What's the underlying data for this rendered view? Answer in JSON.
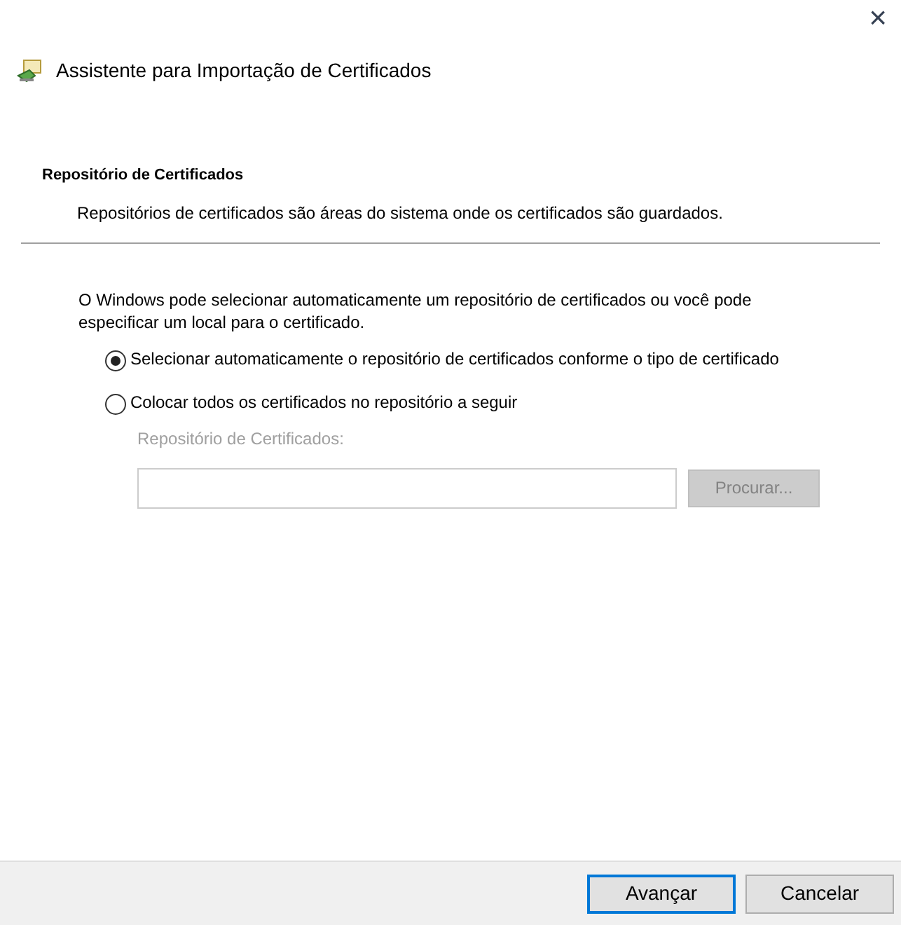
{
  "window": {
    "close": "×",
    "title": "Assistente para Importação de Certificados"
  },
  "header": {
    "heading": "Repositório de Certificados",
    "description": "Repositórios de certificados são áreas do sistema onde os certificados são guardados."
  },
  "intro": "O Windows pode selecionar automaticamente um repositório de certificados ou você pode especificar um local para o certificado.",
  "options": [
    {
      "label": "Selecionar automaticamente o repositório de certificados conforme o tipo de certificado",
      "selected": true
    },
    {
      "label": "Colocar todos os certificados no repositório a seguir",
      "selected": false
    }
  ],
  "store": {
    "label": "Repositório de Certificados:",
    "disabled": true,
    "browse": "Procurar..."
  },
  "buttons": [
    {
      "label": "Avançar",
      "default": true
    },
    {
      "label": "Cancelar",
      "default": false
    }
  ]
}
